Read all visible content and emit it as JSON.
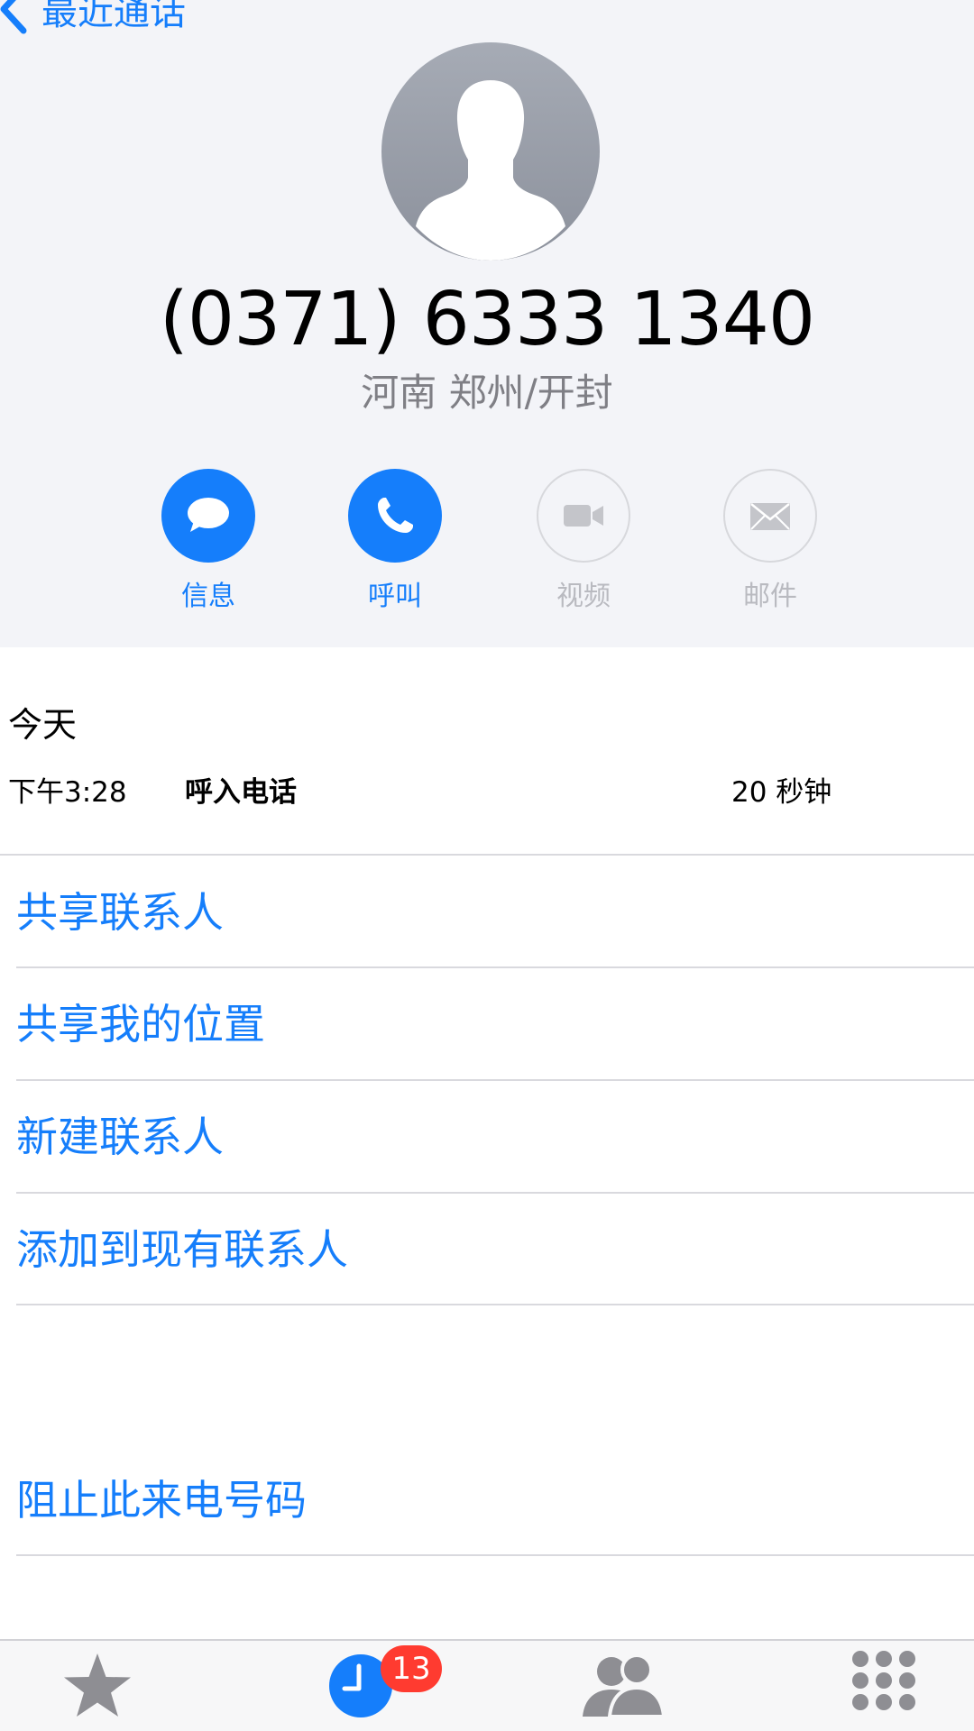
{
  "nav": {
    "back_label": "最近通话"
  },
  "contact": {
    "phone_number": "(0371) 6333 1340",
    "location": "河南 郑州/开封"
  },
  "actions": [
    {
      "label": "信息",
      "icon": "message-bubble-icon",
      "enabled": true
    },
    {
      "label": "呼叫",
      "icon": "phone-icon",
      "enabled": true
    },
    {
      "label": "视频",
      "icon": "video-camera-icon",
      "enabled": false
    },
    {
      "label": "邮件",
      "icon": "envelope-icon",
      "enabled": false
    }
  ],
  "recent": {
    "day": "今天",
    "calls": [
      {
        "time": "下午3:28",
        "type": "呼入电话",
        "duration": "20 秒钟"
      }
    ]
  },
  "options": {
    "share_contact": "共享联系人",
    "share_location": "共享我的位置",
    "new_contact": "新建联系人",
    "add_existing": "添加到现有联系人",
    "block": "阻止此来电号码"
  },
  "tabbar": {
    "tabs": [
      {
        "name": "favorites",
        "icon": "star-icon",
        "selected": false
      },
      {
        "name": "recents",
        "icon": "clock-icon",
        "selected": true
      },
      {
        "name": "contacts",
        "icon": "people-icon",
        "selected": false
      },
      {
        "name": "keypad",
        "icon": "keypad-icon",
        "selected": false
      }
    ],
    "recents_badge": "13"
  },
  "colors": {
    "accent": "#157efb",
    "header_bg": "#f3f4f8",
    "badge": "#ff3b30",
    "disabled": "#b9bac0",
    "tab_inactive": "#8e8e93"
  }
}
